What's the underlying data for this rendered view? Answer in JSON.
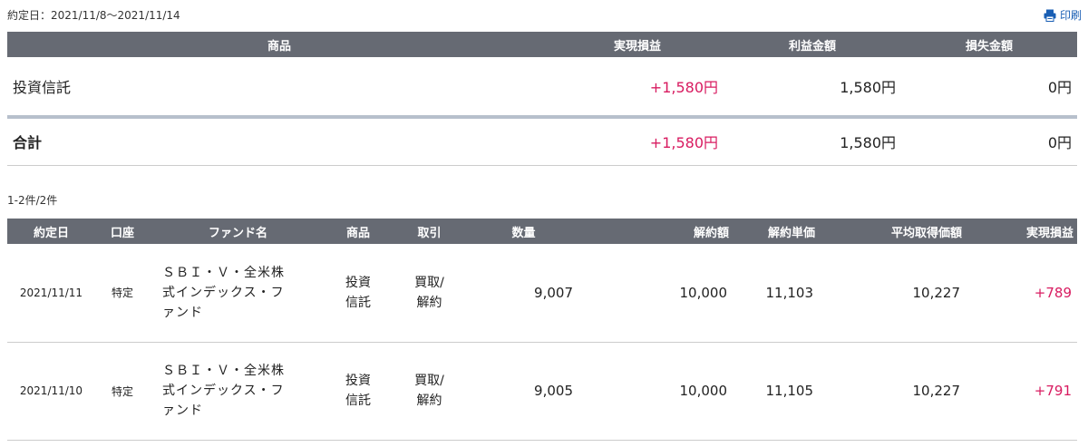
{
  "header": {
    "period": "約定日：2021/11/8～2021/11/14",
    "print_label": "印刷"
  },
  "summary": {
    "columns": [
      "商品",
      "実現損益",
      "利益金額",
      "損失金額"
    ],
    "rows": [
      {
        "product": "投資信託",
        "realized": "+1,580円",
        "profit": "1,580円",
        "loss": "0円"
      }
    ],
    "total": {
      "label": "合計",
      "realized": "+1,580円",
      "profit": "1,580円",
      "loss": "0円"
    }
  },
  "list_count": "1-2件/2件",
  "detail": {
    "columns": [
      "約定日",
      "口座",
      "ファンド名",
      "商品",
      "取引",
      "数量",
      "解約額",
      "解約単価",
      "平均取得価額",
      "実現損益"
    ],
    "rows": [
      {
        "date": "2021/11/11",
        "account": "特定",
        "fund_lines": [
          "ＳＢＩ・Ｖ・全米株",
          "式インデックス・フ",
          "ァンド"
        ],
        "product_lines": [
          "投資",
          "信託"
        ],
        "trade_lines": [
          "買取/",
          "解約"
        ],
        "quantity": "9,007",
        "amount": "10,000",
        "unit_price": "11,103",
        "avg_cost": "10,227",
        "realized": "+789"
      },
      {
        "date": "2021/11/10",
        "account": "特定",
        "fund_lines": [
          "ＳＢＩ・Ｖ・全米株",
          "式インデックス・フ",
          "ァンド"
        ],
        "product_lines": [
          "投資",
          "信託"
        ],
        "trade_lines": [
          "買取/",
          "解約"
        ],
        "quantity": "9,005",
        "amount": "10,000",
        "unit_price": "11,105",
        "avg_cost": "10,227",
        "realized": "+791"
      }
    ]
  },
  "colors": {
    "header_bg": "#666a73",
    "positive": "#d81b60",
    "link": "#1a5fb4",
    "separator": "#b7c0cc"
  },
  "icons": {
    "print": "printer-icon"
  }
}
